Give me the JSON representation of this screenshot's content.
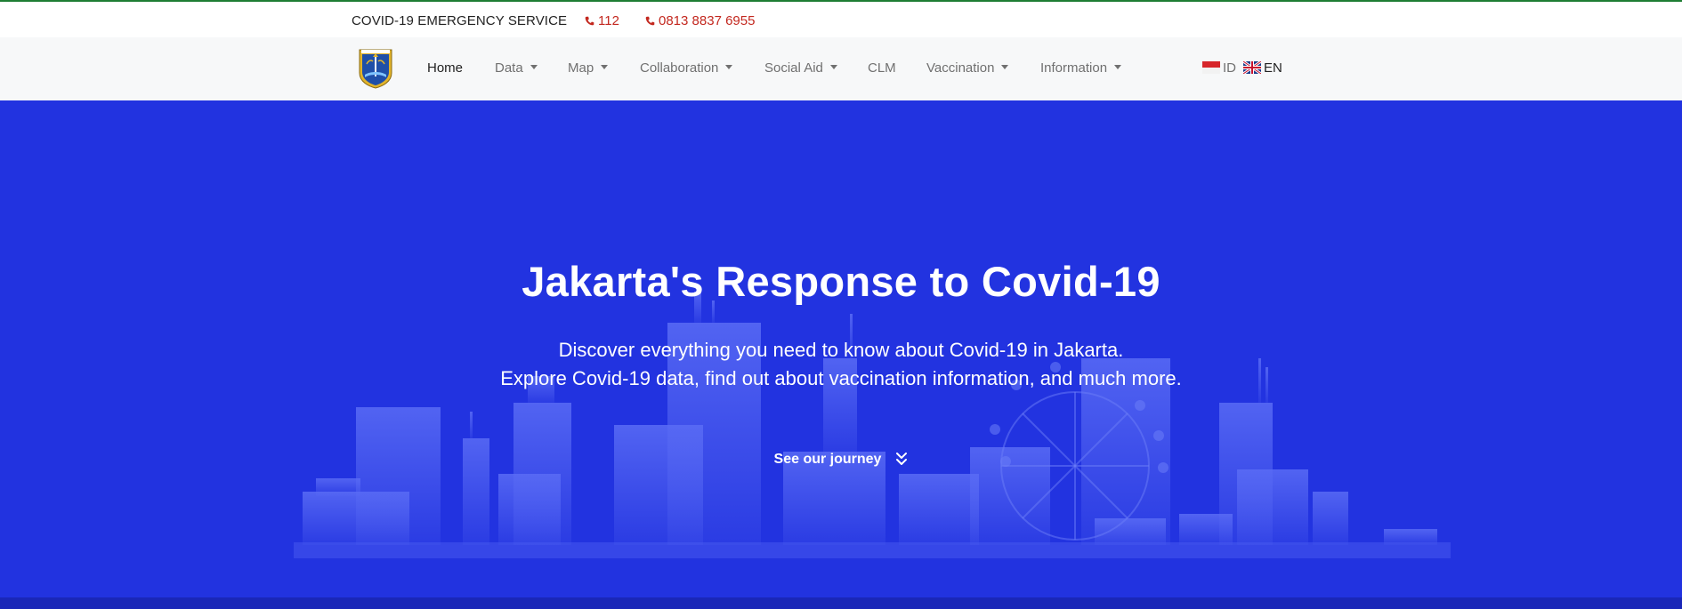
{
  "topbar": {
    "service_label": "COVID-19 EMERGENCY SERVICE",
    "phones": [
      "112",
      "0813 8837 6955"
    ],
    "icon": "phone-icon"
  },
  "navbar": {
    "items": [
      {
        "label": "Home",
        "dropdown": false
      },
      {
        "label": "Data",
        "dropdown": true
      },
      {
        "label": "Map",
        "dropdown": true
      },
      {
        "label": "Collaboration",
        "dropdown": true
      },
      {
        "label": "Social Aid",
        "dropdown": true
      },
      {
        "label": "CLM",
        "dropdown": false
      },
      {
        "label": "Vaccination",
        "dropdown": true
      },
      {
        "label": "Information",
        "dropdown": true
      }
    ],
    "languages": [
      {
        "code": "ID",
        "flag": "indonesia-flag-icon"
      },
      {
        "code": "EN",
        "flag": "uk-flag-icon"
      }
    ],
    "logo": "jakarta-coat-of-arms-logo"
  },
  "hero": {
    "title": "Jakarta's Response to Covid-19",
    "subtitle_line1": "Discover everything you need to know about Covid-19 in Jakarta.",
    "subtitle_line2": "Explore Covid-19 data, find out about vaccination information, and much more.",
    "cta": "See our journey",
    "cta_icon": "double-chevron-down-icon"
  },
  "colors": {
    "hero_bg": "#2233e0",
    "accent_red": "#c3281f",
    "top_border_green": "#1e7d33",
    "navbar_bg": "#f7f8f9"
  }
}
